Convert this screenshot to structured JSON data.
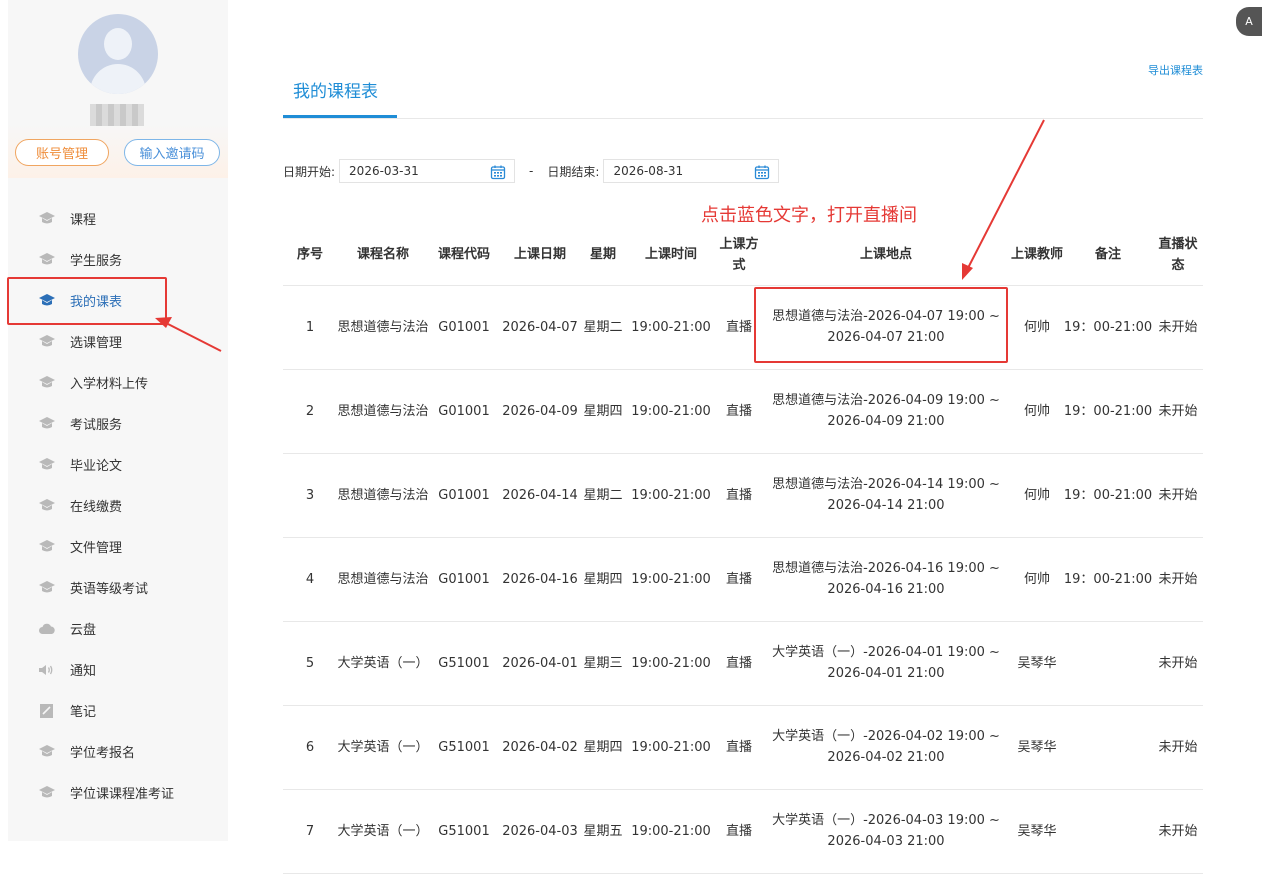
{
  "sidebar": {
    "account_button": "账号管理",
    "invite_button": "输入邀请码",
    "items": [
      {
        "label": "课程",
        "icon": "graduation-cap-icon"
      },
      {
        "label": "学生服务",
        "icon": "graduation-cap-icon"
      },
      {
        "label": "我的课表",
        "icon": "graduation-cap-icon",
        "active": true
      },
      {
        "label": "选课管理",
        "icon": "graduation-cap-icon"
      },
      {
        "label": "入学材料上传",
        "icon": "graduation-cap-icon"
      },
      {
        "label": "考试服务",
        "icon": "graduation-cap-icon"
      },
      {
        "label": "毕业论文",
        "icon": "graduation-cap-icon"
      },
      {
        "label": "在线缴费",
        "icon": "graduation-cap-icon"
      },
      {
        "label": "文件管理",
        "icon": "graduation-cap-icon"
      },
      {
        "label": "英语等级考试",
        "icon": "graduation-cap-icon"
      },
      {
        "label": "云盘",
        "icon": "cloud-icon"
      },
      {
        "label": "通知",
        "icon": "speaker-icon"
      },
      {
        "label": "笔记",
        "icon": "note-icon"
      },
      {
        "label": "学位考报名",
        "icon": "graduation-cap-icon"
      },
      {
        "label": "学位课课程准考证",
        "icon": "graduation-cap-icon"
      }
    ]
  },
  "main": {
    "tab_title": "我的课程表",
    "export_link": "导出课程表",
    "filter": {
      "start_label": "日期开始:",
      "start_value": "2026-03-31",
      "separator": "-",
      "end_label": "日期结束:",
      "end_value": "2026-08-31"
    },
    "annotation": "点击蓝色文字，打开直播间",
    "table": {
      "headers": [
        "序号",
        "课程名称",
        "课程代码",
        "上课日期",
        "星期",
        "上课时间",
        "上课方式",
        "上课地点",
        "上课教师",
        "备注",
        "直播状态"
      ],
      "rows": [
        {
          "no": "1",
          "name": "思想道德与法治",
          "code": "G01001",
          "date": "2026-04-07",
          "weekday": "星期二",
          "time": "19:00-21:00",
          "mode": "直播",
          "location": "思想道德与法治-2026-04-07 19:00 ~ 2026-04-07 21:00",
          "teacher": "何帅",
          "note": "19：00-21:00",
          "status": "未开始"
        },
        {
          "no": "2",
          "name": "思想道德与法治",
          "code": "G01001",
          "date": "2026-04-09",
          "weekday": "星期四",
          "time": "19:00-21:00",
          "mode": "直播",
          "location": "思想道德与法治-2026-04-09 19:00 ~ 2026-04-09 21:00",
          "teacher": "何帅",
          "note": "19：00-21:00",
          "status": "未开始"
        },
        {
          "no": "3",
          "name": "思想道德与法治",
          "code": "G01001",
          "date": "2026-04-14",
          "weekday": "星期二",
          "time": "19:00-21:00",
          "mode": "直播",
          "location": "思想道德与法治-2026-04-14 19:00 ~ 2026-04-14 21:00",
          "teacher": "何帅",
          "note": "19：00-21:00",
          "status": "未开始"
        },
        {
          "no": "4",
          "name": "思想道德与法治",
          "code": "G01001",
          "date": "2026-04-16",
          "weekday": "星期四",
          "time": "19:00-21:00",
          "mode": "直播",
          "location": "思想道德与法治-2026-04-16 19:00 ~ 2026-04-16 21:00",
          "teacher": "何帅",
          "note": "19：00-21:00",
          "status": "未开始"
        },
        {
          "no": "5",
          "name": "大学英语（一）",
          "code": "G51001",
          "date": "2026-04-01",
          "weekday": "星期三",
          "time": "19:00-21:00",
          "mode": "直播",
          "location": "大学英语（一）-2026-04-01 19:00 ~ 2026-04-01 21:00",
          "teacher": "吴琴华",
          "note": "",
          "status": "未开始"
        },
        {
          "no": "6",
          "name": "大学英语（一）",
          "code": "G51001",
          "date": "2026-04-02",
          "weekday": "星期四",
          "time": "19:00-21:00",
          "mode": "直播",
          "location": "大学英语（一）-2026-04-02 19:00 ~ 2026-04-02 21:00",
          "teacher": "吴琴华",
          "note": "",
          "status": "未开始"
        },
        {
          "no": "7",
          "name": "大学英语（一）",
          "code": "G51001",
          "date": "2026-04-03",
          "weekday": "星期五",
          "time": "19:00-21:00",
          "mode": "直播",
          "location": "大学英语（一）-2026-04-03 19:00 ~ 2026-04-03 21:00",
          "teacher": "吴琴华",
          "note": "",
          "status": "未开始"
        }
      ]
    }
  },
  "corner_button": "A",
  "colors": {
    "accent": "#1f8dd6",
    "annotation_red": "#e53935"
  }
}
